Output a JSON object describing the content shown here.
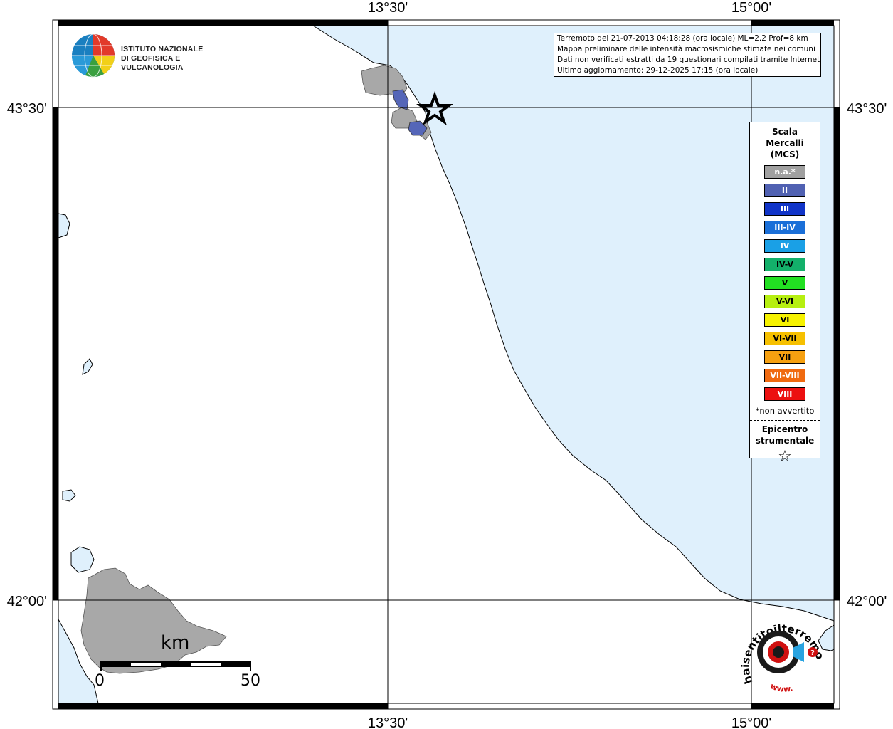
{
  "map": {
    "axis_labels": {
      "top_left_lon": "13°30'",
      "top_right_lon": "15°00'",
      "bottom_left_lon": "13°30'",
      "bottom_right_lon": "15°00'",
      "left_top_lat": "43°30'",
      "left_bottom_lat": "42°00'",
      "right_top_lat": "43°30'",
      "right_bottom_lat": "42°00'"
    },
    "colors": {
      "sea": "#dff0fc",
      "land": "#ffffff",
      "na_fill": "#a8a8a8",
      "II_fill": "#5566b8"
    }
  },
  "logo": {
    "line1": "ISTITUTO NAZIONALE",
    "line2": "DI GEOFISICA E VULCANOLOGIA"
  },
  "info": {
    "line1": "Terremoto del 21-07-2013 04:18:28 (ora locale) ML=2.2 Prof=8 km",
    "line2": "Mappa preliminare delle intensità macrosismiche stimate nei comuni",
    "line3": "Dati non verificati estratti da 19 questionari compilati tramite Internet.",
    "line4": "Ultimo aggiornamento: 29-12-2025 17:15 (ora locale)"
  },
  "legend": {
    "title_line1": "Scala",
    "title_line2": "Mercalli",
    "title_line3": "(MCS)",
    "items": [
      {
        "label": "n.a.*",
        "color": "#a0a0a0"
      },
      {
        "label": "II",
        "color": "#5061b2"
      },
      {
        "label": "III",
        "color": "#1034c8"
      },
      {
        "label": "III-IV",
        "color": "#1a6fd8"
      },
      {
        "label": "IV",
        "color": "#1aa0e6"
      },
      {
        "label": "IV-V",
        "color": "#13b06a"
      },
      {
        "label": "V",
        "color": "#22e022"
      },
      {
        "label": "V-VI",
        "color": "#b6ef10"
      },
      {
        "label": "VI",
        "color": "#f6f200"
      },
      {
        "label": "VI-VII",
        "color": "#f6c000"
      },
      {
        "label": "VII",
        "color": "#f6a010"
      },
      {
        "label": "VII-VIII",
        "color": "#f06a10"
      },
      {
        "label": "VIII",
        "color": "#ec1010"
      }
    ],
    "note": "*non avvertito",
    "epicenter_line1": "Epicentro",
    "epicenter_line2": "strumentale",
    "star": "☆"
  },
  "scale_bar": {
    "unit": "km",
    "start": "0",
    "end": "50"
  },
  "watermark": {
    "text": "haisentitoilterremoto.it",
    "url": "www."
  }
}
